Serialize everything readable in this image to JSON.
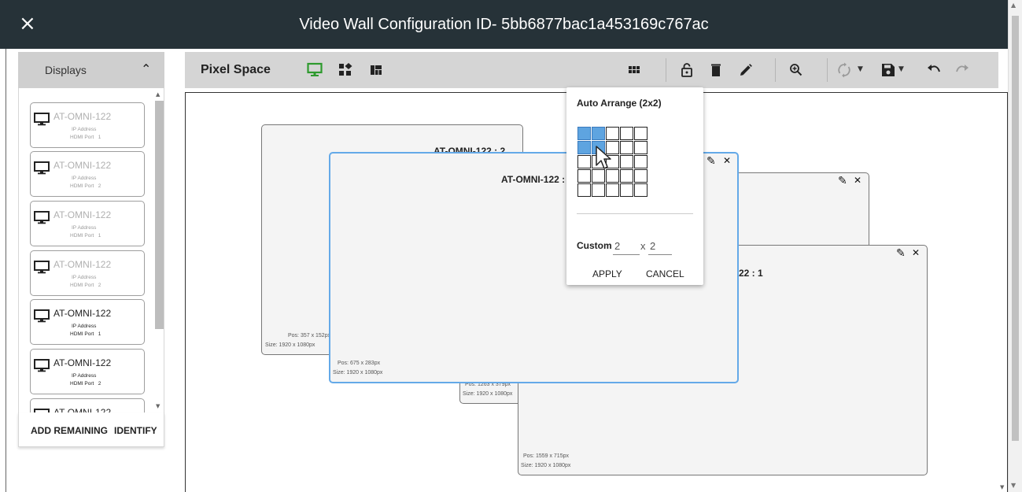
{
  "header": {
    "close_label": "×",
    "title": "Video Wall Configuration ID- 5bb6877bac1a453169c767ac"
  },
  "sidebar": {
    "title": "Displays",
    "collapse_icon": "chevron-up-icon",
    "items": [
      {
        "name": "AT-OMNI-122",
        "ip_label": "IP Address",
        "port_label": "HDMI Port",
        "port": "1",
        "state": "dim"
      },
      {
        "name": "AT-OMNI-122",
        "ip_label": "IP Address",
        "port_label": "HDMI Port",
        "port": "2",
        "state": "dim"
      },
      {
        "name": "AT-OMNI-122",
        "ip_label": "IP Address",
        "port_label": "HDMI Port",
        "port": "1",
        "state": "dim"
      },
      {
        "name": "AT-OMNI-122",
        "ip_label": "IP Address",
        "port_label": "HDMI Port",
        "port": "2",
        "state": "dim"
      },
      {
        "name": "AT-OMNI-122",
        "ip_label": "IP Address",
        "port_label": "HDMI Port",
        "port": "1",
        "state": "active"
      },
      {
        "name": "AT-OMNI-122",
        "ip_label": "IP Address",
        "port_label": "HDMI Port",
        "port": "2",
        "state": "active"
      },
      {
        "name": "AT-OMNI-122",
        "ip_label": "",
        "port_label": "",
        "port": "",
        "state": "active"
      }
    ],
    "add_remaining_label": "ADD REMAINING",
    "identify_label": "IDENTIFY"
  },
  "toolbar": {
    "title": "Pixel Space",
    "icons": [
      "monitor-icon",
      "layout-icon",
      "dashboard-icon",
      "grid-icon",
      "lock-open-icon",
      "delete-icon",
      "edit-icon",
      "zoom-in-icon",
      "sync-icon",
      "save-icon",
      "undo-icon",
      "redo-icon"
    ],
    "accent_color": "#2e9a2e"
  },
  "screens": [
    {
      "label": "AT-OMNI-122 : 2",
      "pos": "Pos: 357 x 152px",
      "size": "Size: 1920 x 1080px"
    },
    {
      "label": "AT-OMNI-122 :",
      "pos": "Pos: 675 x 283px",
      "size": "Size: 1920 x 1080px",
      "selected": true
    },
    {
      "label": "",
      "pos": "Pos: 1263 x 379px",
      "size": "Size: 1920 x 1080px"
    },
    {
      "label": "22 : 1",
      "pos": "Pos: 1559 x 715px",
      "size": "Size: 1920 x 1080px"
    }
  ],
  "screen_controls": {
    "edit_glyph": "✎",
    "close_glyph": "✕"
  },
  "popup": {
    "title": "Auto Arrange (2x2)",
    "selected_rows": 2,
    "selected_cols": 2,
    "grid_rows": 5,
    "grid_cols": 5,
    "custom_label": "Custom",
    "custom_rows": "2",
    "custom_cols_prefix": "x",
    "custom_cols": "2",
    "apply_label": "APPLY",
    "cancel_label": "CANCEL",
    "highlight_color": "#5ea4e0"
  }
}
